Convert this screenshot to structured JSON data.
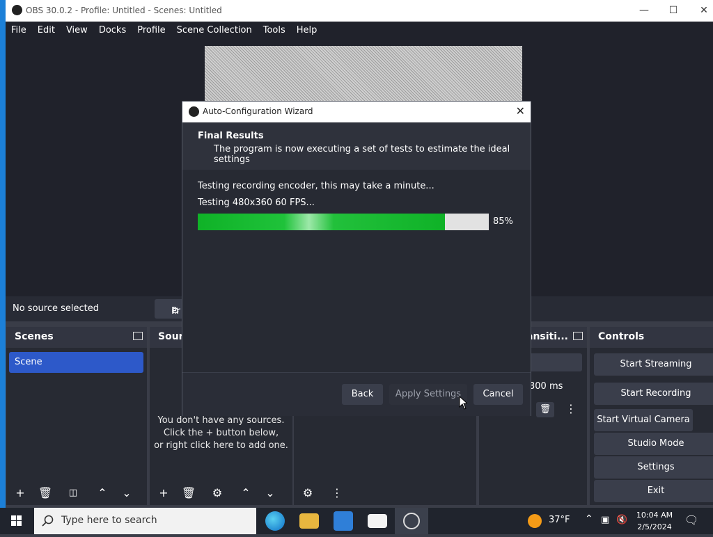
{
  "window": {
    "title": "OBS 30.0.2 - Profile: Untitled - Scenes: Untitled"
  },
  "menu": [
    "File",
    "Edit",
    "View",
    "Docks",
    "Profile",
    "Scene Collection",
    "Tools",
    "Help"
  ],
  "source_bar": {
    "status": "No source selected",
    "properties_label": "Pr"
  },
  "scenes": {
    "title": "Scenes",
    "items": [
      "Scene"
    ]
  },
  "sources": {
    "title": "Sourc",
    "empty_msg_1": "You don't have any sources.",
    "empty_msg_2": "Click the + button below,",
    "empty_msg_3": "or right click here to add one."
  },
  "transitions": {
    "title": "ansiti...",
    "duration": "300 ms"
  },
  "controls": {
    "title": "Controls",
    "buttons": [
      "Start Streaming",
      "Start Recording",
      "Start Virtual Camera",
      "Studio Mode",
      "Settings",
      "Exit"
    ]
  },
  "dialog": {
    "title": "Auto-Configuration Wizard",
    "heading": "Final Results",
    "subheading": "The program is now executing a set of tests to estimate the ideal settings",
    "status_line_1": "Testing recording encoder, this may take a minute...",
    "status_line_2": "Testing 480x360 60 FPS...",
    "progress": 85,
    "progress_label": "85%",
    "back_label": "Back",
    "apply_label": "Apply Settings",
    "cancel_label": "Cancel"
  },
  "taskbar": {
    "search_placeholder": "Type here to search",
    "weather": "37°F",
    "time": "10:04 AM",
    "date": "2/5/2024"
  },
  "colors": {
    "accent": "#2d59c9",
    "progress_green": "#0fb227",
    "panel": "#272a33"
  }
}
